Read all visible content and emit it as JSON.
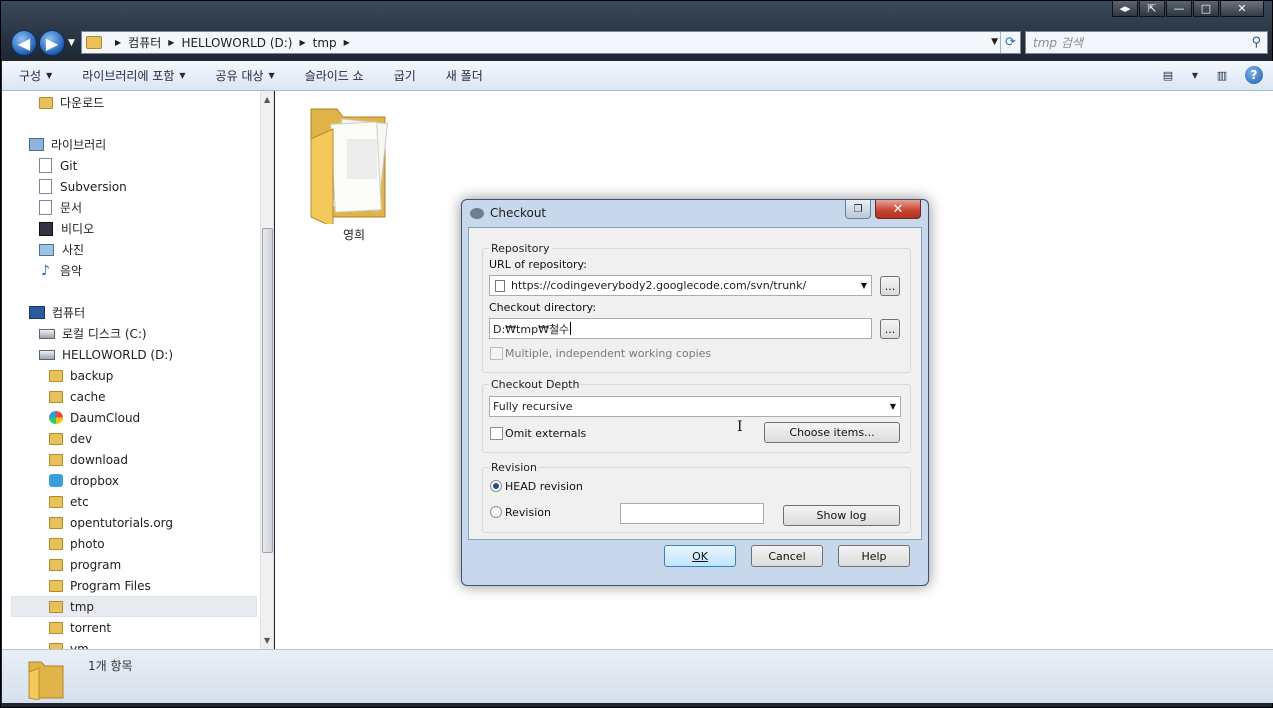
{
  "window": {
    "caption_buttons": [
      "◂▸",
      "⇱",
      "—",
      "□",
      "✕"
    ]
  },
  "address": {
    "crumbs": [
      "컴퓨터",
      "HELLOWORLD (D:)",
      "tmp"
    ],
    "search_placeholder": "tmp 검색"
  },
  "toolbar": {
    "items": [
      {
        "label": "구성",
        "has_arrow": true
      },
      {
        "label": "라이브러리에 포함",
        "has_arrow": true
      },
      {
        "label": "공유 대상",
        "has_arrow": true
      },
      {
        "label": "슬라이드 쇼",
        "has_arrow": false
      },
      {
        "label": "굽기",
        "has_arrow": false
      },
      {
        "label": "새 폴더",
        "has_arrow": false
      }
    ]
  },
  "sidebar": {
    "items": [
      {
        "label": "다운로드",
        "icon": "download-folder-icon"
      },
      {
        "label": "라이브러리",
        "icon": "library-icon"
      },
      {
        "label": "Git",
        "icon": "git-library-icon"
      },
      {
        "label": "Subversion",
        "icon": "subversion-library-icon"
      },
      {
        "label": "문서",
        "icon": "documents-icon"
      },
      {
        "label": "비디오",
        "icon": "video-icon"
      },
      {
        "label": "사진",
        "icon": "pictures-icon"
      },
      {
        "label": "음악",
        "icon": "music-icon"
      },
      {
        "label": "컴퓨터",
        "icon": "computer-icon"
      },
      {
        "label": "로컬 디스크 (C:)",
        "icon": "local-disk-icon"
      },
      {
        "label": "HELLOWORLD (D:)",
        "icon": "drive-icon"
      },
      {
        "label": "backup",
        "icon": "folder-icon"
      },
      {
        "label": "cache",
        "icon": "folder-icon"
      },
      {
        "label": "DaumCloud",
        "icon": "daumcloud-icon"
      },
      {
        "label": "dev",
        "icon": "folder-icon"
      },
      {
        "label": "download",
        "icon": "folder-icon"
      },
      {
        "label": "dropbox",
        "icon": "dropbox-icon"
      },
      {
        "label": "etc",
        "icon": "folder-icon"
      },
      {
        "label": "opentutorials.org",
        "icon": "folder-icon"
      },
      {
        "label": "photo",
        "icon": "folder-icon"
      },
      {
        "label": "program",
        "icon": "folder-icon"
      },
      {
        "label": "Program Files",
        "icon": "folder-icon"
      },
      {
        "label": "tmp",
        "icon": "folder-icon",
        "selected": true
      },
      {
        "label": "torrent",
        "icon": "folder-icon"
      },
      {
        "label": "vm",
        "icon": "folder-icon"
      }
    ]
  },
  "content": {
    "folder_name": "영희"
  },
  "status": {
    "count_text": "1개 항목"
  },
  "dialog": {
    "title": "Checkout",
    "repository_group": "Repository",
    "url_label": "URL of repository:",
    "url_value": "https://codingeverybody2.googlecode.com/svn/trunk/",
    "browse_label": "...",
    "dir_label": "Checkout directory:",
    "dir_value": "D:₩tmp₩철수",
    "multiple_label": "Multiple, independent working copies",
    "depth_group": "Checkout Depth",
    "depth_value": "Fully recursive",
    "omit_externals_label": "Omit externals",
    "choose_items_label": "Choose items...",
    "revision_group": "Revision",
    "head_revision_label": "HEAD revision",
    "revision_label": "Revision",
    "show_log_label": "Show log",
    "ok_label": "OK",
    "cancel_label": "Cancel",
    "help_label": "Help"
  }
}
